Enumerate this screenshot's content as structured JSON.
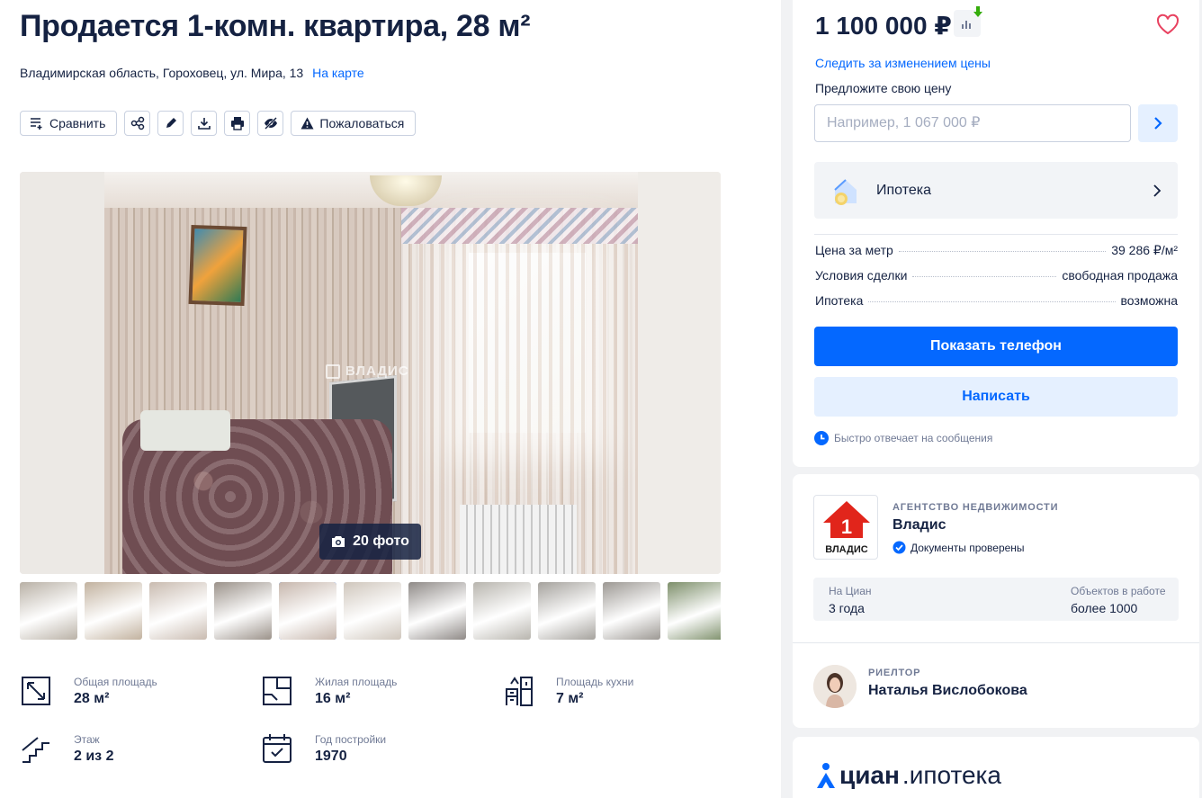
{
  "listing": {
    "title": "Продается 1-комн. квартира, 28 м²",
    "address": "Владимирская область, Гороховец, ул. Мира, 13",
    "map_link": "На карте"
  },
  "toolbar": {
    "compare_label": "Сравнить",
    "report_label": "Пожаловаться",
    "icons": [
      "compare-icon",
      "share-icon",
      "edit-icon",
      "download-icon",
      "print-icon",
      "hide-icon",
      "warning-icon"
    ]
  },
  "gallery": {
    "photo_count_label": "20 фото",
    "watermark": "ВЛАДИС",
    "active_thumb_index": 4,
    "thumb_colors": [
      "#b9b1a6",
      "#c2b29f",
      "#c9bbb0",
      "#9b928a",
      "#c7b7ad",
      "#cfc6bc",
      "#8f8a87",
      "#b8b5ae",
      "#a5a29d",
      "#9c9893",
      "#7d8f6a"
    ]
  },
  "features": [
    {
      "label": "Общая площадь",
      "value": "28 м²",
      "icon": "area-icon"
    },
    {
      "label": "Жилая площадь",
      "value": "16 м²",
      "icon": "living-area-icon"
    },
    {
      "label": "Площадь кухни",
      "value": "7 м²",
      "icon": "kitchen-icon"
    },
    {
      "label": "Этаж",
      "value": "2 из 2",
      "icon": "stairs-icon"
    },
    {
      "label": "Год постройки",
      "value": "1970",
      "icon": "calendar-icon"
    }
  ],
  "price_card": {
    "price": "1 100 000 ₽",
    "track_link": "Следить за изменением цены",
    "offer_label": "Предложите свою цену",
    "offer_placeholder": "Например, 1 067 000 ₽",
    "mortgage_label": "Ипотека",
    "info_rows": [
      {
        "label": "Цена за метр",
        "value": "39 286 ₽/м²"
      },
      {
        "label": "Условия сделки",
        "value": "свободная продажа"
      },
      {
        "label": "Ипотека",
        "value": "возможна"
      }
    ],
    "show_phone_label": "Показать телефон",
    "write_label": "Написать",
    "fast_reply": "Быстро отвечает на сообщения"
  },
  "agency": {
    "type": "АГЕНТСТВО НЕДВИЖИМОСТИ",
    "name": "Владис",
    "logo_text": "ВЛАДИС",
    "verified": "Документы проверены",
    "stats": [
      {
        "label": "На Циан",
        "value": "3 года"
      },
      {
        "label": "Объектов в работе",
        "value": "более 1000"
      }
    ]
  },
  "realtor": {
    "type": "РИЕЛТОР",
    "name": "Наталья Вислобокова"
  },
  "promo": {
    "logo_bold": "циан",
    "logo_rest": ".ипотека"
  },
  "colors": {
    "accent": "#0468ff",
    "text": "#152242",
    "muted": "#707a95",
    "heart": "#e84260",
    "agency_red": "#e1251b"
  }
}
